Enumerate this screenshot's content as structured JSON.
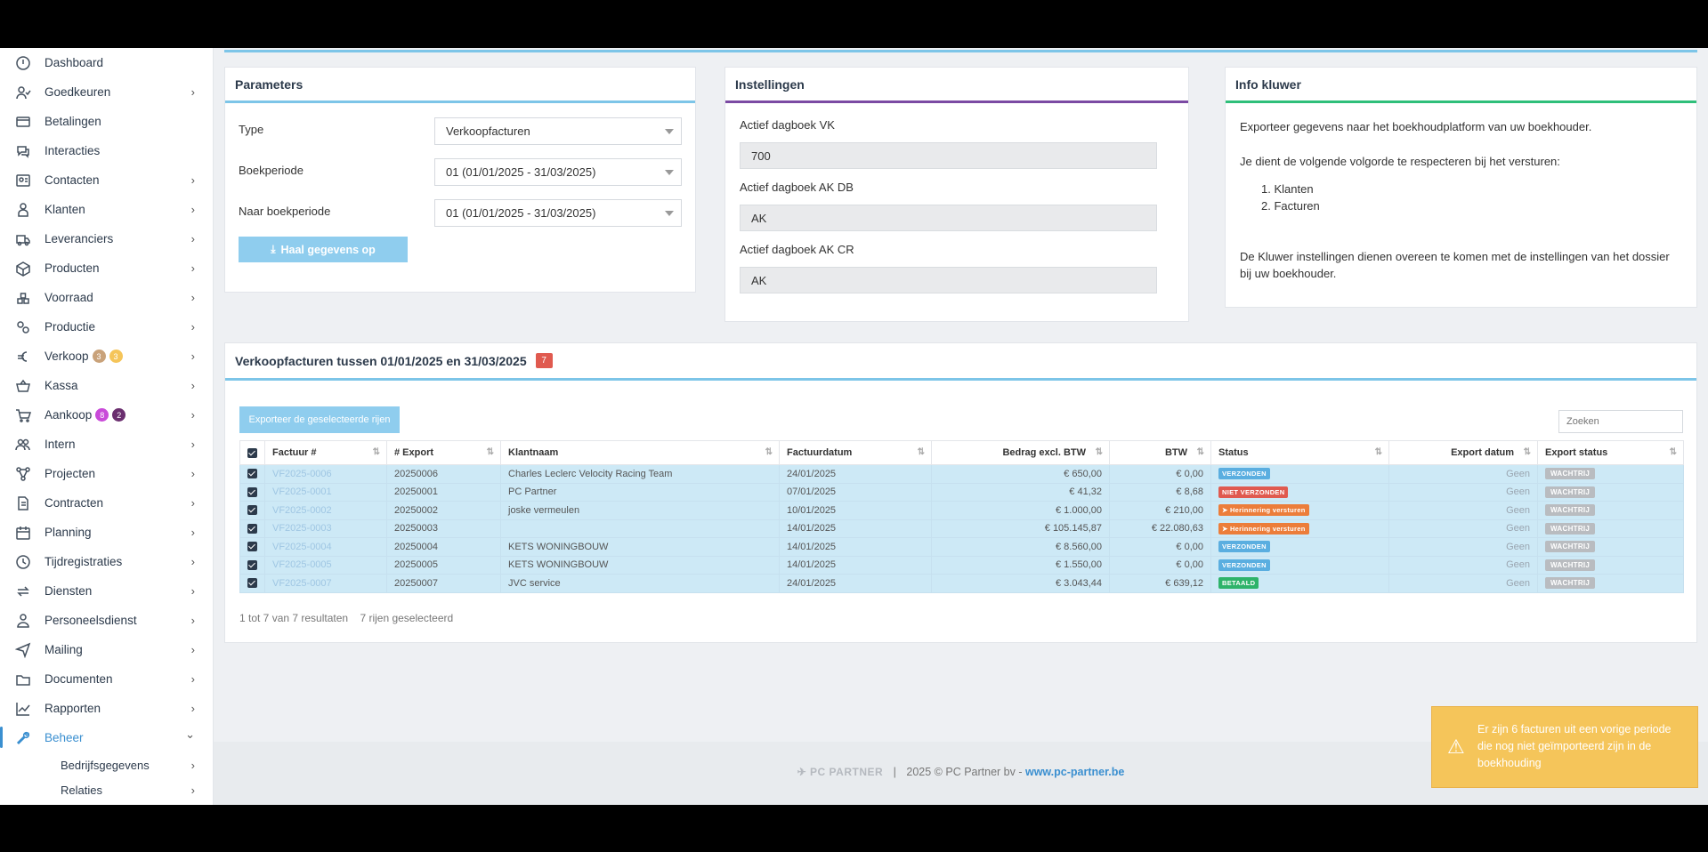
{
  "sidebar": {
    "items": [
      {
        "label": "Dashboard",
        "icon": "dashboard-icon",
        "chev": false
      },
      {
        "label": "Goedkeuren",
        "icon": "user-check-icon",
        "chev": true
      },
      {
        "label": "Betalingen",
        "icon": "credit-card-icon",
        "chev": false
      },
      {
        "label": "Interacties",
        "icon": "chat-icon",
        "chev": false
      },
      {
        "label": "Contacten",
        "icon": "contact-card-icon",
        "chev": true
      },
      {
        "label": "Klanten",
        "icon": "customer-icon",
        "chev": true
      },
      {
        "label": "Leveranciers",
        "icon": "truck-icon",
        "chev": true
      },
      {
        "label": "Producten",
        "icon": "box-icon",
        "chev": true
      },
      {
        "label": "Voorraad",
        "icon": "stock-icon",
        "chev": true
      },
      {
        "label": "Productie",
        "icon": "gears-icon",
        "chev": true
      },
      {
        "label": "Verkoop",
        "icon": "euro-icon",
        "chev": true
      },
      {
        "label": "Kassa",
        "icon": "basket-icon",
        "chev": true
      },
      {
        "label": "Aankoop",
        "icon": "cart-icon",
        "chev": true
      },
      {
        "label": "Intern",
        "icon": "users-icon",
        "chev": true
      },
      {
        "label": "Projecten",
        "icon": "project-icon",
        "chev": true
      },
      {
        "label": "Contracten",
        "icon": "contract-icon",
        "chev": true
      },
      {
        "label": "Planning",
        "icon": "calendar-icon",
        "chev": true
      },
      {
        "label": "Tijdregistraties",
        "icon": "clock-icon",
        "chev": true
      },
      {
        "label": "Diensten",
        "icon": "repeat-icon",
        "chev": true
      },
      {
        "label": "Personeelsdienst",
        "icon": "staff-icon",
        "chev": true
      },
      {
        "label": "Mailing",
        "icon": "send-icon",
        "chev": true
      },
      {
        "label": "Documenten",
        "icon": "folder-icon",
        "chev": true
      },
      {
        "label": "Rapporten",
        "icon": "chart-line-icon",
        "chev": true
      },
      {
        "label": "Beheer",
        "icon": "wrench-icon",
        "chev": true
      }
    ],
    "verkoop_badges": [
      "3",
      "3"
    ],
    "aankoop_badges": [
      "8",
      "2"
    ],
    "sub_items": [
      "Bedrijfsgegevens",
      "Relaties"
    ]
  },
  "parameters": {
    "title": "Parameters",
    "type_label": "Type",
    "type_value": "Verkoopfacturen",
    "boekperiode_label": "Boekperiode",
    "boekperiode_value": "01 (01/01/2025 - 31/03/2025)",
    "naar_label": "Naar boekperiode",
    "naar_value": "01 (01/01/2025 - 31/03/2025)",
    "fetch_button": "Haal gegevens op"
  },
  "instellingen": {
    "title": "Instellingen",
    "vk_label": "Actief dagboek VK",
    "vk_value": "700",
    "akdb_label": "Actief dagboek AK DB",
    "akdb_value": "AK",
    "akcr_label": "Actief dagboek AK CR",
    "akcr_value": "AK"
  },
  "info": {
    "title": "Info kluwer",
    "line1": "Exporteer gegevens naar het boekhoudplatform van uw boekhouder.",
    "line2": "Je dient de volgende volgorde te respecteren bij het versturen:",
    "list": [
      "Klanten",
      "Facturen"
    ],
    "line3": "De Kluwer instellingen dienen overeen te komen met de instellingen van het dossier bij uw boekhouder."
  },
  "invoices": {
    "title": "Verkoopfacturen tussen 01/01/2025 en 31/03/2025",
    "count": "7",
    "export_button": "Exporteer de geselecteerde rijen",
    "search_placeholder": "Zoeken",
    "columns": [
      "Factuur #",
      "# Export",
      "Klantnaam",
      "Factuurdatum",
      "Bedrag excl. BTW",
      "BTW",
      "Status",
      "Export datum",
      "Export status"
    ],
    "rows": [
      {
        "factuur": "VF2025-0006",
        "export": "20250006",
        "klant": "Charles Leclerc Velocity Racing Team",
        "datum": "24/01/2025",
        "bedrag": "€ 650,00",
        "btw": "€ 0,00",
        "status": "VERZONDEN",
        "status_color": "#5aaee0",
        "exportdatum": "Geen",
        "exportstatus": "WACHTRIJ"
      },
      {
        "factuur": "VF2025-0001",
        "export": "20250001",
        "klant": "PC Partner",
        "datum": "07/01/2025",
        "bedrag": "€ 41,32",
        "btw": "€ 8,68",
        "status": "NIET VERZONDEN",
        "status_color": "#e05a4f",
        "exportdatum": "Geen",
        "exportstatus": "WACHTRIJ"
      },
      {
        "factuur": "VF2025-0002",
        "export": "20250002",
        "klant": "joske vermeulen",
        "datum": "10/01/2025",
        "bedrag": "€ 1.000,00",
        "btw": "€ 210,00",
        "status": "Herinnering versturen",
        "status_color": "#ec7d3a",
        "exportdatum": "Geen",
        "exportstatus": "WACHTRIJ"
      },
      {
        "factuur": "VF2025-0003",
        "export": "20250003",
        "klant": "",
        "datum": "14/01/2025",
        "bedrag": "€ 105.145,87",
        "btw": "€ 22.080,63",
        "status": "Herinnering versturen",
        "status_color": "#ec7d3a",
        "exportdatum": "Geen",
        "exportstatus": "WACHTRIJ"
      },
      {
        "factuur": "VF2025-0004",
        "export": "20250004",
        "klant": "KETS WONINGBOUW",
        "datum": "14/01/2025",
        "bedrag": "€ 8.560,00",
        "btw": "€ 0,00",
        "status": "VERZONDEN",
        "status_color": "#5aaee0",
        "exportdatum": "Geen",
        "exportstatus": "WACHTRIJ"
      },
      {
        "factuur": "VF2025-0005",
        "export": "20250005",
        "klant": "KETS WONINGBOUW",
        "datum": "14/01/2025",
        "bedrag": "€ 1.550,00",
        "btw": "€ 0,00",
        "status": "VERZONDEN",
        "status_color": "#5aaee0",
        "exportdatum": "Geen",
        "exportstatus": "WACHTRIJ"
      },
      {
        "factuur": "VF2025-0007",
        "export": "20250007",
        "klant": "JVC service",
        "datum": "24/01/2025",
        "bedrag": "€ 3.043,44",
        "btw": "€ 639,12",
        "status": "BETAALD",
        "status_color": "#2eb36a",
        "exportdatum": "Geen",
        "exportstatus": "WACHTRIJ"
      }
    ],
    "summary": "1 tot 7 van 7 resultaten",
    "selected": "7 rijen geselecteerd"
  },
  "footer": {
    "logo_text": "PC PARTNER",
    "copyright": "2025 © PC Partner bv - ",
    "link": "www.pc-partner.be"
  },
  "toast": {
    "text": "Er zijn 6 facturen uit een vorige periode die nog niet geïmporteerd zijn in de boekhouding"
  }
}
